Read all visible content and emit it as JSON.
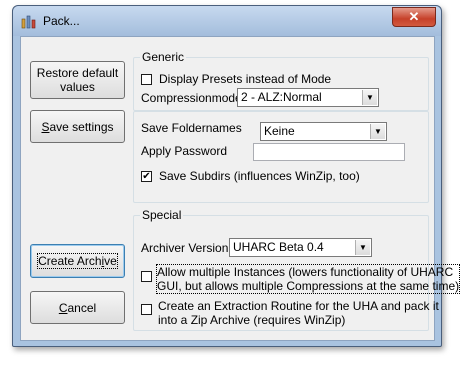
{
  "window": {
    "title": "Pack...",
    "close_symbol": "✕"
  },
  "left_buttons": {
    "restore_line1": "Restore default",
    "restore_line2": "values",
    "save_settings_pre": "",
    "save_settings_ul": "S",
    "save_settings_post": "ave settings",
    "create_archive_pre": "Create Arch",
    "create_archive_ul": "i",
    "create_archive_post": "ve",
    "cancel_pre": "",
    "cancel_ul": "C",
    "cancel_post": "ancel"
  },
  "generic": {
    "legend": "Generic",
    "display_presets_label": "Display Presets instead of Mode",
    "display_presets_checked": false,
    "compressionmode_label": "Compressionmode",
    "compressionmode_value": "2 - ALZ:Normal"
  },
  "folders": {
    "save_foldernames_label": "Save Foldernames",
    "save_foldernames_value": "Keine",
    "apply_password_label": "Apply Password",
    "apply_password_value": "",
    "save_subdirs_label": "Save Subdirs (influences WinZip, too)",
    "save_subdirs_checked": true,
    "check_mark": "✔"
  },
  "special": {
    "legend": "Special",
    "archiver_version_label": "Archiver Version:",
    "archiver_version_value": "UHARC Beta 0.4",
    "allow_multiple_line1": "Allow multiple Instances (lowers functionality of UHARC",
    "allow_multiple_line2": "GUI, but allows multiple Compressions at the same time)",
    "allow_multiple_checked": false,
    "extraction_line1": "Create an Extraction Routine for the UHA and pack it",
    "extraction_line2": "into a Zip Archive (requires WinZip)",
    "extraction_checked": false
  },
  "icons": {
    "app": "pack-app-icon",
    "dropdown": "▼"
  }
}
